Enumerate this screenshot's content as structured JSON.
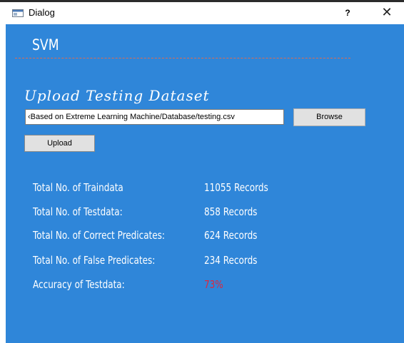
{
  "window": {
    "title": "Dialog",
    "help_label": "?",
    "close_label": "✕"
  },
  "dialog": {
    "heading": "SVM",
    "section_title": "Upload Testing Dataset",
    "file_path_value": "‹Based on Extreme Learning Machine/Database/testing.csv",
    "browse_label": "Browse",
    "upload_label": "Upload"
  },
  "stats": [
    {
      "label": "Total No. of Traindata",
      "value": "11055 Records"
    },
    {
      "label": "Total No. of Testdata:",
      "value": "858 Records"
    },
    {
      "label": "Total No. of Correct Predicates:",
      "value": "624 Records"
    },
    {
      "label": "Total No. of False Predicates:",
      "value": "234 Records"
    },
    {
      "label": "Accuracy of Testdata:",
      "value": "73%"
    }
  ],
  "colors": {
    "client_bg": "#2f86d9",
    "accent_value": "#e0263c",
    "divider": "#e06a4f"
  }
}
